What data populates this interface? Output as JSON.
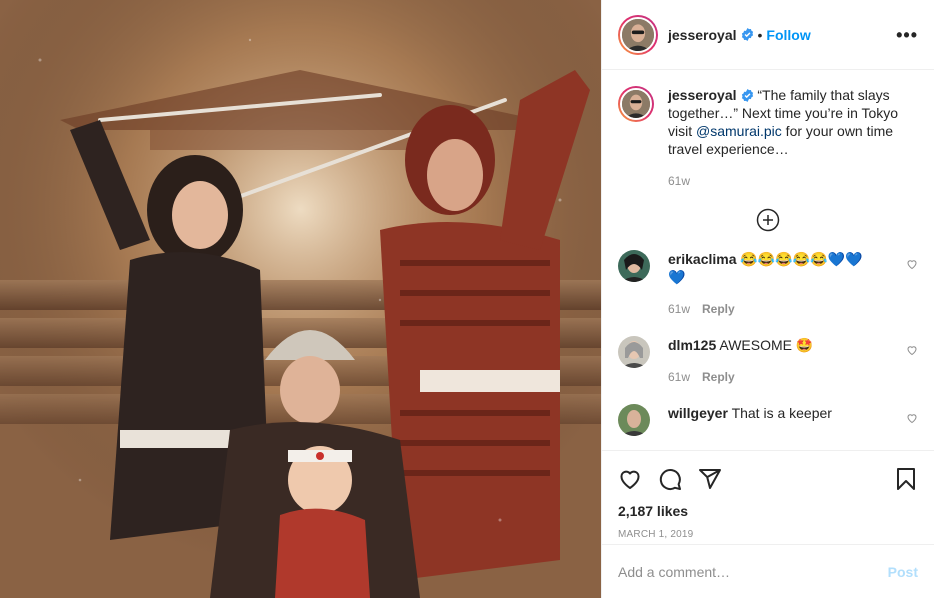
{
  "post": {
    "username": "jesseroyal",
    "follow_label": "Follow",
    "dot": "•",
    "more_label": "•••",
    "caption_text": "“The family that slays together…” Next time you’re in Tokyo visit ",
    "caption_mention": "@samurai.pic",
    "caption_tail": " for your own time travel experience…",
    "caption_time": "61w",
    "likes": "2,187 likes",
    "date": "MARCH 1, 2019",
    "comment_placeholder": "Add a comment…",
    "post_label": "Post"
  },
  "comments": [
    {
      "username": "erikaclima",
      "text": "😂😂😂😂😂💙💙 💙",
      "time": "61w",
      "reply": "Reply"
    },
    {
      "username": "dlm125",
      "text": "AWESOME 🤩",
      "time": "61w",
      "reply": "Reply"
    },
    {
      "username": "willgeyer",
      "text": "That is a keeper"
    }
  ],
  "colors": {
    "link": "#0095f6",
    "mention": "#00376b",
    "muted": "#8e8e8e",
    "post_disabled": "#b2dffc"
  },
  "icons": [
    "verified-badge-icon",
    "heart-icon",
    "comment-icon",
    "share-icon",
    "bookmark-icon",
    "plus-circle-icon",
    "more-icon"
  ]
}
